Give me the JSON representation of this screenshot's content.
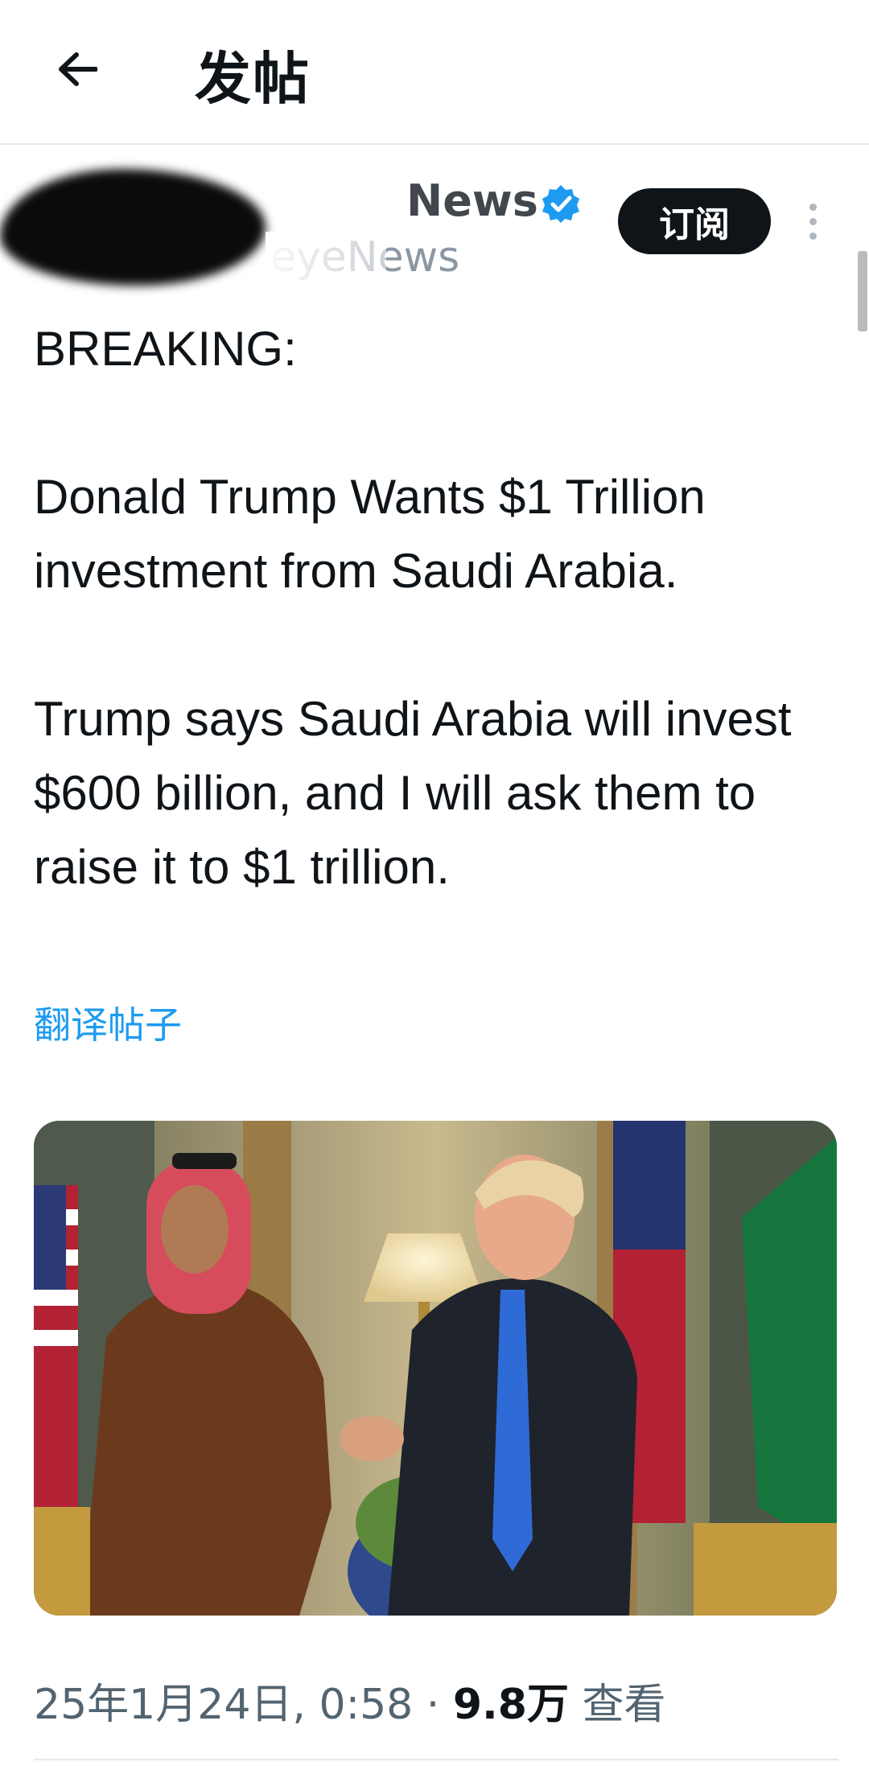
{
  "header": {
    "back_icon": "arrow-left-icon",
    "title": "发帖"
  },
  "author": {
    "display_name": "News",
    "handle": "eyeNews",
    "verified_icon": "verified-badge-icon",
    "verified_color": "#1d9bf0",
    "subscribe_label": "订阅",
    "more_icon": "more-vertical-icon"
  },
  "post": {
    "lines": [
      "BREAKING:",
      "Donald Trump Wants $1 Trillion investment from Saudi Arabia.",
      "Trump says Saudi Arabia will invest $600 billion, and I will ask them to raise it to $1 trillion."
    ],
    "translate_label": "翻译帖子",
    "media_description_icon": "photo-image"
  },
  "meta": {
    "datetime": "25年1月24日, 0:58",
    "separator": "·",
    "views_count": "9.8万",
    "views_label": "查看"
  },
  "colors": {
    "accent": "#1d9bf0",
    "text": "#0f1419",
    "secondary": "#536471"
  }
}
